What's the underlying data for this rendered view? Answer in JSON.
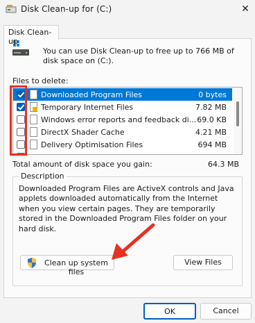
{
  "window": {
    "title": "Disk Clean-up for  (C:)",
    "close_label": "✕"
  },
  "tab": {
    "label": "Disk Clean-up"
  },
  "intro": {
    "text": "You can use Disk Clean-up to free up to 766 MB of disk space on  (C:)."
  },
  "files": {
    "label": "Files to delete:",
    "items": [
      {
        "name": "Downloaded Program Files",
        "size": "0 bytes",
        "checked": true,
        "selected": true,
        "icon": "file-icon"
      },
      {
        "name": "Temporary Internet Files",
        "size": "7.82 MB",
        "checked": true,
        "selected": false,
        "icon": "locked-file-icon"
      },
      {
        "name": "Windows error reports and feedback di...",
        "size": "69.0 KB",
        "checked": false,
        "selected": false,
        "icon": "file-icon"
      },
      {
        "name": "DirectX Shader Cache",
        "size": "4.21 MB",
        "checked": false,
        "selected": false,
        "icon": "file-icon"
      },
      {
        "name": "Delivery Optimisation Files",
        "size": "694 MB",
        "checked": false,
        "selected": false,
        "icon": "file-icon"
      }
    ]
  },
  "total": {
    "label": "Total amount of disk space you gain:",
    "value": "64.3 MB"
  },
  "description": {
    "title": "Description",
    "text": "Downloaded Program Files are ActiveX controls and Java applets downloaded automatically from the Internet when you view certain pages. They are temporarily stored in the Downloaded Program Files folder on your hard disk."
  },
  "buttons": {
    "cleanup_system": "Clean up system files",
    "view_files": "View Files",
    "ok": "OK",
    "cancel": "Cancel"
  },
  "colors": {
    "selection": "#0078d7",
    "annotation": "#e53222",
    "accent": "#005fb8"
  }
}
